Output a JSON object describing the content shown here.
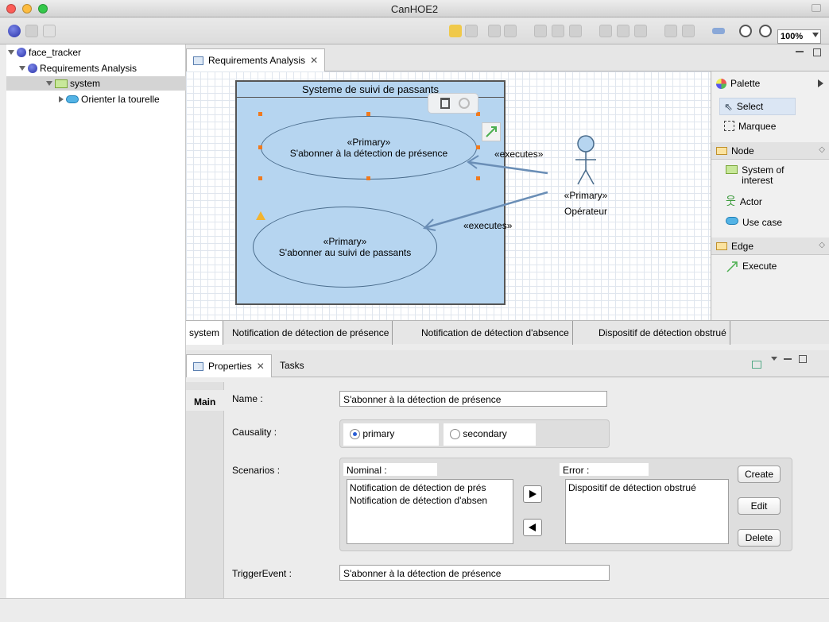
{
  "window": {
    "title": "CanHOE2"
  },
  "toolbar": {
    "zoom": "100%"
  },
  "tree": {
    "items": [
      {
        "label": "face_tracker",
        "icon": "project-ball-icon"
      },
      {
        "label": "Requirements Analysis",
        "icon": "project-ball-icon"
      },
      {
        "label": "system",
        "icon": "folder-icon"
      },
      {
        "label": "Orienter la tourelle",
        "icon": "use-case-icon"
      }
    ]
  },
  "editor": {
    "tab_label": "Requirements Analysis"
  },
  "diagram": {
    "system_name": "Systeme de suivi de passants",
    "usecase1": {
      "stereotype": "«Primary»",
      "name": "S'abonner à la détection de présence"
    },
    "usecase2": {
      "stereotype": "«Primary»",
      "name": "S'abonner au suivi de passants"
    },
    "actor": {
      "stereotype": "«Primary»",
      "name": "Opérateur"
    },
    "edge1_label": "«executes»",
    "edge2_label": "«executes»"
  },
  "palette": {
    "title": "Palette",
    "select": "Select",
    "marquee": "Marquee",
    "node_header": "Node",
    "node_items": [
      "System of interest",
      "Actor",
      "Use case"
    ],
    "edge_header": "Edge",
    "edge_items": [
      "Execute"
    ]
  },
  "subtabs": [
    "system",
    "Notification de détection de présence",
    "Notification de détection d'absence",
    "Dispositif de détection obstrué"
  ],
  "properties": {
    "tab_label": "Properties",
    "tasks_label": "Tasks",
    "side_tab": "Main",
    "name_label": "Name :",
    "name_value": "S'abonner à la détection de présence",
    "causality_label": "Causality :",
    "primary": "primary",
    "secondary": "secondary",
    "scenarios_label": "Scenarios :",
    "nominal_label": "Nominal :",
    "nominal_items": [
      "Notification de détection de prés",
      "Notification de détection d'absen"
    ],
    "error_label": "Error :",
    "error_items": [
      "Dispositif de détection obstrué"
    ],
    "create": "Create",
    "edit": "Edit",
    "delete": "Delete",
    "trigger_label": "TriggerEvent :",
    "trigger_value": "S'abonner à la détection de présence"
  }
}
